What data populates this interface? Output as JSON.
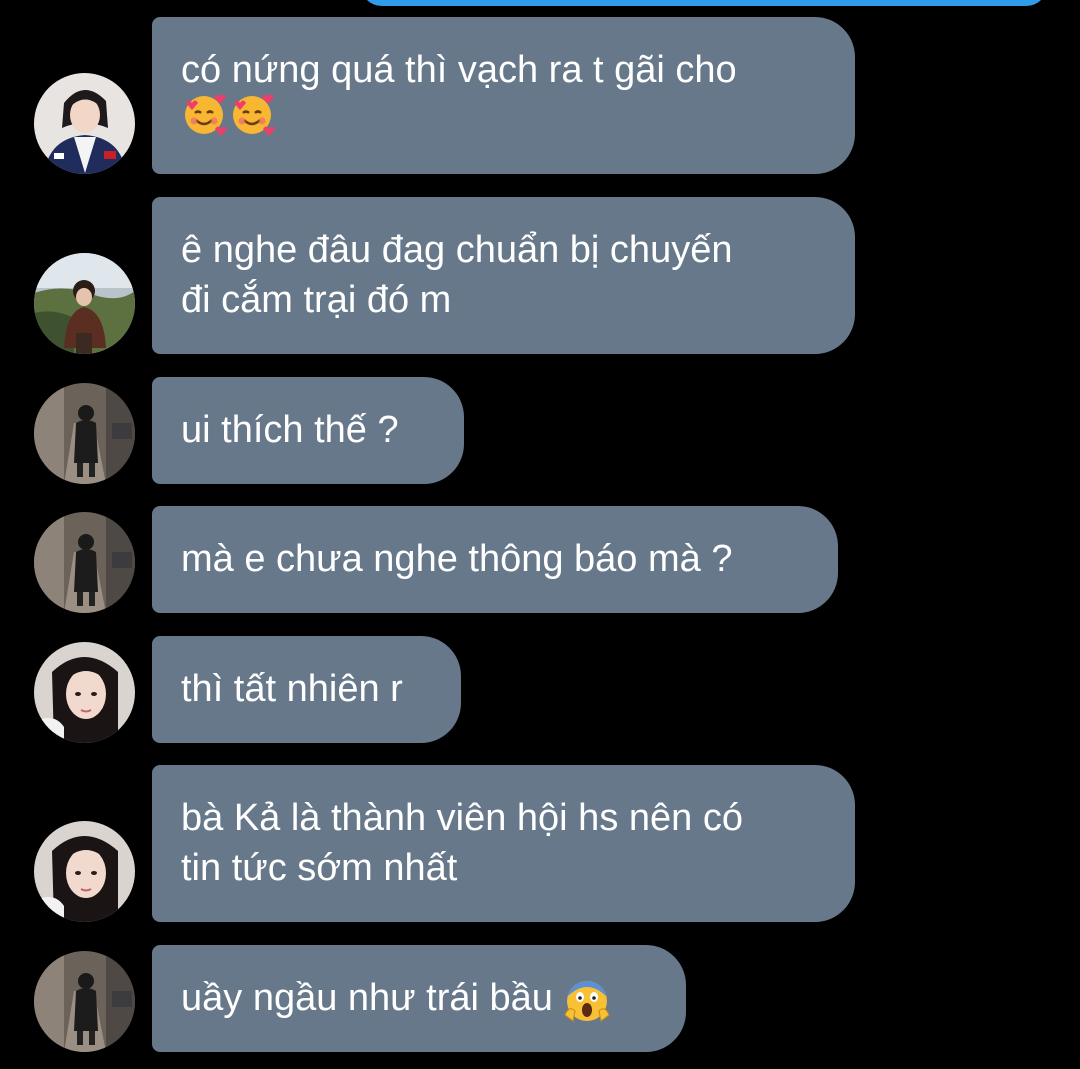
{
  "messages": [
    {
      "text": "có nứng quá thì vạch ra t gãi cho",
      "emoji": [
        "smiling-face-with-hearts",
        "smiling-face-with-hearts"
      ]
    },
    {
      "text": "ê nghe đâu đag chuẩn bị chuyến\nđi cắm trại đó m"
    },
    {
      "text": "ui thích thế ?"
    },
    {
      "text": "mà e chưa nghe thông báo mà ?"
    },
    {
      "text": "thì tất nhiên r"
    },
    {
      "text": "bà Kả là thành viên hội hs nên có\ntin tức sớm nhất"
    },
    {
      "text": "uầy ngầu như trái bầu",
      "emoji": [
        "screaming-face"
      ]
    }
  ],
  "colors": {
    "background": "#000000",
    "bubble": "#66788a",
    "text": "#ffffff",
    "sent_bubble": "#2f9bea"
  }
}
